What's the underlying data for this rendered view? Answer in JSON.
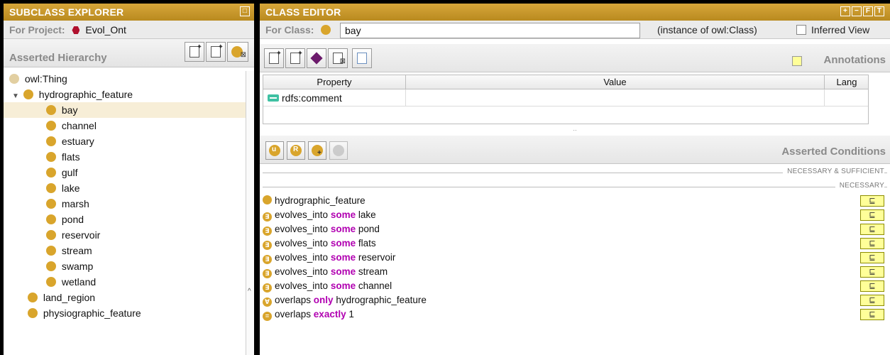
{
  "colors": {
    "accent": "#c8982c",
    "keyword": "#b100b1",
    "class_dot": "#d9a52c",
    "project_icon": "#b0112e"
  },
  "left": {
    "title": "SUBCLASS EXPLORER",
    "for_label": "For Project:",
    "project_name": "Evol_Ont",
    "section_title": "Asserted Hierarchy",
    "tree": [
      {
        "label": "owl:Thing",
        "level": 0
      },
      {
        "label": "hydrographic_feature",
        "level": 1,
        "expanded": true
      },
      {
        "label": "bay",
        "level": 2,
        "selected": true
      },
      {
        "label": "channel",
        "level": 2
      },
      {
        "label": "estuary",
        "level": 2
      },
      {
        "label": "flats",
        "level": 2
      },
      {
        "label": "gulf",
        "level": 2
      },
      {
        "label": "lake",
        "level": 2
      },
      {
        "label": "marsh",
        "level": 2
      },
      {
        "label": "pond",
        "level": 2
      },
      {
        "label": "reservoir",
        "level": 2
      },
      {
        "label": "stream",
        "level": 2
      },
      {
        "label": "swamp",
        "level": 2
      },
      {
        "label": "wetland",
        "level": 2
      },
      {
        "label": "land_region",
        "level": 1
      },
      {
        "label": "physiographic_feature",
        "level": 1
      }
    ]
  },
  "right": {
    "title": "CLASS EDITOR",
    "for_label": "For Class:",
    "class_name": "bay",
    "instance_of": "(instance of owl:Class)",
    "inferred_view_label": "Inferred View",
    "annotations_title": "Annotations",
    "table": {
      "headers": [
        "Property",
        "Value",
        "Lang"
      ],
      "rows": [
        {
          "property": "rdfs:comment",
          "value": "",
          "lang": ""
        }
      ]
    },
    "conditions_title": "Asserted Conditions",
    "necessary_sufficient_label": "NECESSARY & SUFFICIENT",
    "necessary_label": "NECESSARY",
    "conditions": [
      {
        "icon": "class",
        "prop": "",
        "kw": "",
        "filler": "hydrographic_feature"
      },
      {
        "icon": "∃",
        "prop": "evolves_into",
        "kw": "some",
        "filler": "lake"
      },
      {
        "icon": "∃",
        "prop": "evolves_into",
        "kw": "some",
        "filler": "pond"
      },
      {
        "icon": "∃",
        "prop": "evolves_into",
        "kw": "some",
        "filler": "flats"
      },
      {
        "icon": "∃",
        "prop": "evolves_into",
        "kw": "some",
        "filler": "reservoir"
      },
      {
        "icon": "∃",
        "prop": "evolves_into",
        "kw": "some",
        "filler": "stream"
      },
      {
        "icon": "∃",
        "prop": "evolves_into",
        "kw": "some",
        "filler": "channel"
      },
      {
        "icon": "∀",
        "prop": "overlaps",
        "kw": "only",
        "filler": "hydrographic_feature"
      },
      {
        "icon": "=",
        "prop": "overlaps",
        "kw": "exactly",
        "filler": "1"
      }
    ],
    "subsumption_symbol": "⊑"
  }
}
